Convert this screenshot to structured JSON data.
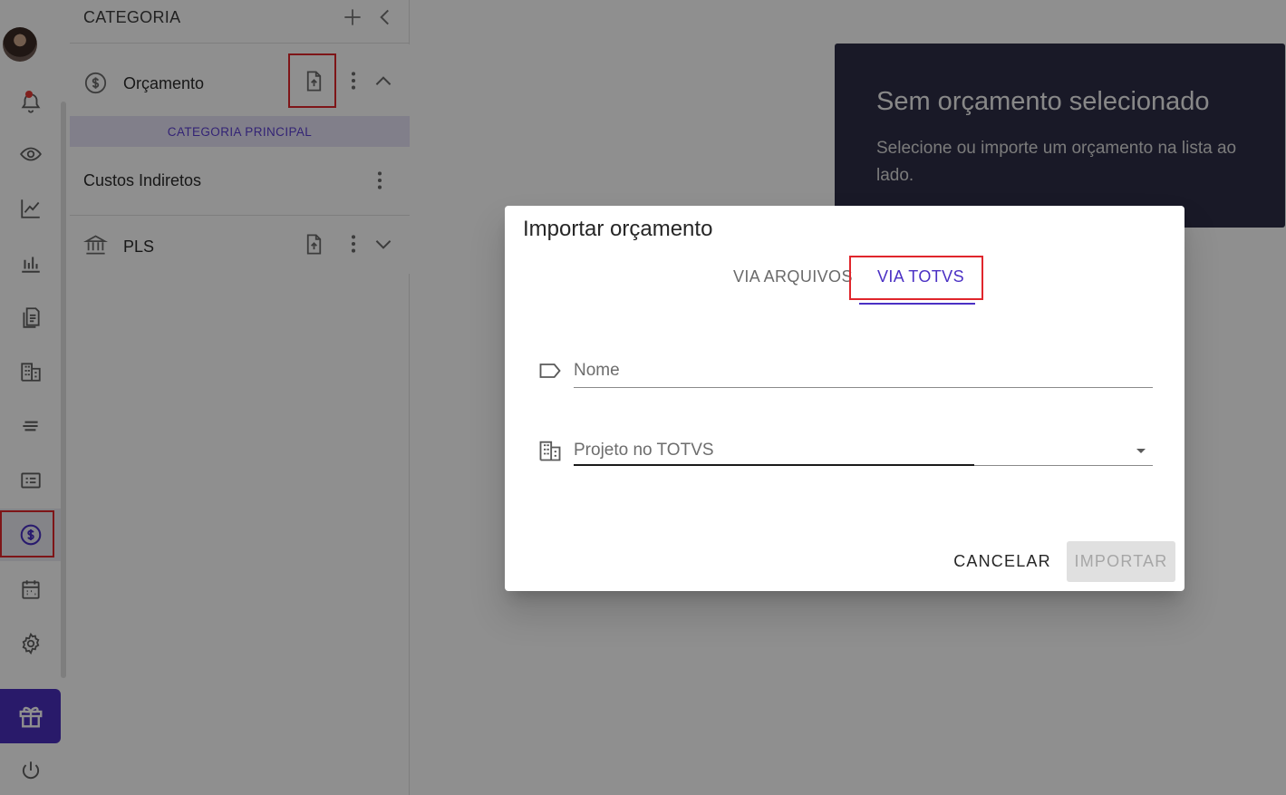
{
  "rail": {
    "items": [
      "notifications",
      "view",
      "trends",
      "charts",
      "documents",
      "company",
      "lines",
      "list",
      "budget",
      "calendar",
      "settings",
      "gift",
      "logout"
    ]
  },
  "category_panel": {
    "title": "CATEGORIA",
    "items": [
      {
        "label": "Orçamento",
        "icon": "dollar-circle-icon",
        "expanded": true
      },
      {
        "label": "PLS",
        "icon": "bank-icon",
        "expanded": false
      }
    ],
    "sub_category_header": "CATEGORIA PRINCIPAL",
    "sub_items": [
      {
        "label": "Custos Indiretos"
      }
    ]
  },
  "notice": {
    "title": "Sem orçamento selecionado",
    "body": "Selecione ou importe um orçamento na lista ao lado."
  },
  "dialog": {
    "title": "Importar orçamento",
    "tabs": [
      {
        "label": "VIA ARQUIVOS",
        "active": false
      },
      {
        "label": "VIA TOTVS",
        "active": true
      }
    ],
    "fields": {
      "name": {
        "placeholder": "Nome",
        "value": ""
      },
      "project": {
        "placeholder": "Projeto no TOTVS",
        "value": ""
      }
    },
    "cancel_label": "CANCELAR",
    "import_label": "IMPORTAR"
  },
  "colors": {
    "accent": "#4a30c4",
    "notice_bg": "#2d2d46",
    "highlight_box": "#e0262c",
    "notification_dot": "#e53935"
  }
}
